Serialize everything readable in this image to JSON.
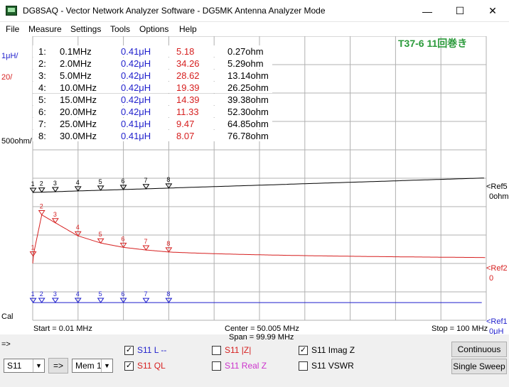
{
  "window": {
    "title": "DG8SAQ  -  Vector Network Analyzer Software - DG5MK Antenna Analyzer Mode",
    "minimize_glyph": "—",
    "maximize_glyph": "☐",
    "close_glyph": "✕"
  },
  "menu": [
    "File",
    "Measure",
    "Settings",
    "Tools",
    "Options",
    "Help"
  ],
  "plot": {
    "annotation": "T37-6 11回巻き",
    "scale_labels": {
      "l_scale": "1μH/",
      "q_scale": "20/",
      "z_scale": "500ohm/",
      "cal": "Cal"
    },
    "table": [
      {
        "idx": "1:",
        "freq": "0.1MHz",
        "l": "0.41μH",
        "q": "5.18",
        "z": "0.27ohm"
      },
      {
        "idx": "2:",
        "freq": "2.0MHz",
        "l": "0.42μH",
        "q": "34.26",
        "z": "5.29ohm"
      },
      {
        "idx": "3:",
        "freq": "5.0MHz",
        "l": "0.42μH",
        "q": "28.62",
        "z": "13.14ohm"
      },
      {
        "idx": "4:",
        "freq": "10.0MHz",
        "l": "0.42μH",
        "q": "19.39",
        "z": "26.25ohm"
      },
      {
        "idx": "5:",
        "freq": "15.0MHz",
        "l": "0.42μH",
        "q": "14.39",
        "z": "39.38ohm"
      },
      {
        "idx": "6:",
        "freq": "20.0MHz",
        "l": "0.42μH",
        "q": "11.33",
        "z": "52.30ohm"
      },
      {
        "idx": "7:",
        "freq": "25.0MHz",
        "l": "0.41μH",
        "q": "9.47",
        "z": "64.85ohm"
      },
      {
        "idx": "8:",
        "freq": "30.0MHz",
        "l": "0.41μH",
        "q": "8.07",
        "z": "76.78ohm"
      }
    ],
    "ref_labels": {
      "ref5_line1": "<Ref5",
      "ref5_line2": "0ohm",
      "ref2_line1": "<Ref2",
      "ref2_line2": "0",
      "ref1_line1": "<Ref1",
      "ref1_line2": "0μH"
    },
    "freq_axis": {
      "start": "Start = 0.01 MHz",
      "center": "Center = 50.005 MHz",
      "span": "Span = 99.99 MHz",
      "stop": "Stop = 100 MHz"
    },
    "marker_labels": [
      "1",
      "2",
      "3",
      "4",
      "5",
      "6",
      "7",
      "8"
    ],
    "marker_freqs_mhz": [
      0.1,
      2.0,
      5.0,
      10.0,
      15.0,
      20.0,
      25.0,
      30.0
    ]
  },
  "controls": {
    "arrow_label": "=>",
    "port_select": "S11",
    "go_button": "=>",
    "mem_select": "Mem 1",
    "traces": [
      {
        "label": "S11  L --",
        "checked": true,
        "checkmark": "✓",
        "color": "#1f1fcc"
      },
      {
        "label": "S11  QL",
        "checked": true,
        "checkmark": "✓",
        "color": "#d61f1f"
      },
      {
        "label": "S11  |Z|",
        "checked": false,
        "checkmark": "",
        "color": "#d61f1f"
      },
      {
        "label": "S11  Real Z",
        "checked": false,
        "checkmark": "",
        "color": "#cc33cc"
      },
      {
        "label": "S11  Imag Z",
        "checked": true,
        "checkmark": "✓",
        "color": "#000000"
      },
      {
        "label": "S11  VSWR",
        "checked": false,
        "checkmark": "",
        "color": "#000000"
      }
    ],
    "continuous_button": "Continuous",
    "single_sweep_button": "Single Sweep"
  },
  "colors": {
    "l_trace": "#1f1fcc",
    "q_trace": "#d61f1f",
    "z_trace": "#000000",
    "annotation": "#2a9a3a",
    "grid": "#b0b0b0"
  },
  "chart_data": {
    "type": "line",
    "title": "T37-6 11回巻き",
    "xlabel": "",
    "ylabel": "",
    "xlim": [
      0.01,
      100
    ],
    "x": [
      0.1,
      2.0,
      5.0,
      10.0,
      15.0,
      20.0,
      25.0,
      30.0
    ],
    "series": [
      {
        "name": "S11  L --",
        "unit": "μH",
        "scale_per_div": 1,
        "values": [
          0.41,
          0.42,
          0.42,
          0.42,
          0.42,
          0.42,
          0.41,
          0.41
        ]
      },
      {
        "name": "S11  QL",
        "unit": "",
        "scale_per_div": 20,
        "values": [
          5.18,
          34.26,
          28.62,
          19.39,
          14.39,
          11.33,
          9.47,
          8.07
        ]
      },
      {
        "name": "S11  Imag Z",
        "unit": "ohm",
        "scale_per_div": 500,
        "values": [
          0.27,
          5.29,
          13.14,
          26.25,
          39.38,
          52.3,
          64.85,
          76.78
        ]
      }
    ],
    "grid": true
  }
}
